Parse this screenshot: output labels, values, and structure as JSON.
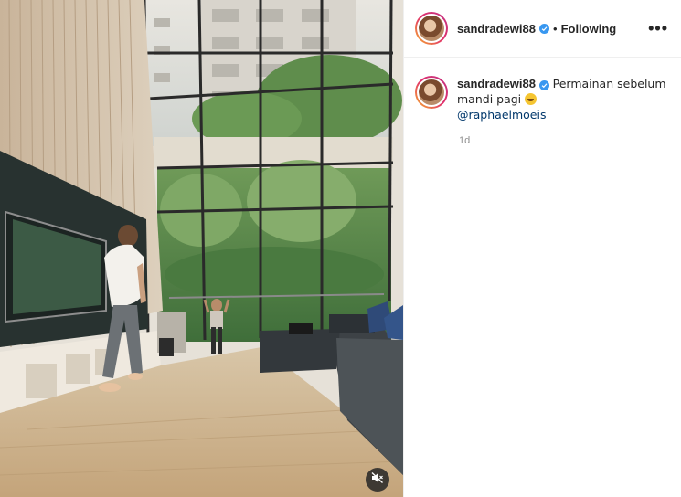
{
  "author": {
    "username": "sandradewi88",
    "follow_status": "Following",
    "separator": "•",
    "verified_icon": "verified-badge-icon"
  },
  "header": {
    "more_label": "•••"
  },
  "caption": {
    "username": "sandradewi88",
    "text": "Permainan sebelum mandi pagi",
    "emoji": "rolling-on-floor-laughing-emoji",
    "mention": "@raphaelmoeis",
    "timestamp": "1d"
  },
  "media": {
    "type": "video",
    "mute_icon": "muted-speaker-icon"
  },
  "colors": {
    "verified": "#3897f0",
    "mention": "#00376b",
    "muted_text": "#8e8e8e"
  }
}
